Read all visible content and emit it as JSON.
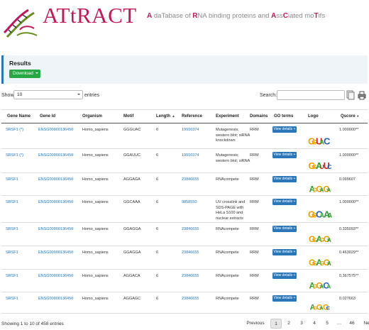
{
  "header": {
    "brand": "ATtRACT",
    "tagline_parts": [
      {
        "t": "A",
        "hl": true
      },
      {
        "t": " daTabase of ",
        "hl": false
      },
      {
        "t": "R",
        "hl": true
      },
      {
        "t": "NA binding proteins and ",
        "hl": false
      },
      {
        "t": "A",
        "hl": true
      },
      {
        "t": "ss",
        "hl": false
      },
      {
        "t": "C",
        "hl": true
      },
      {
        "t": "iated mo",
        "hl": false
      },
      {
        "t": "T",
        "hl": true
      },
      {
        "t": "ifs",
        "hl": false
      }
    ]
  },
  "results": {
    "title": "Results",
    "download_label": "Download"
  },
  "controls": {
    "show_label": "Show",
    "page_size": "10",
    "entries_label": "entries",
    "search_label": "Search:",
    "search_value": ""
  },
  "columns": [
    "Gene Name",
    "Gene Id",
    "Organism",
    "Motif",
    "Length",
    "Reference",
    "Experiment",
    "Domains",
    "GO terms",
    "Logo",
    "Qscore"
  ],
  "rows": [
    {
      "gene_name": "SRSF1 (*)",
      "gene_id": "ENSG00000136450",
      "organism": "Homo_sapiens",
      "motif": "GGGUAC",
      "length": "6",
      "reference": "19910374",
      "experiment": "Mutagenesis; western blot; siRNA knockdown",
      "domains": "RRM",
      "go_button": "View details +",
      "logo": "GGUAC",
      "qscore": "1.000000**"
    },
    {
      "gene_name": "SRSF1 (*)",
      "gene_id": "ENSG00000136450",
      "organism": "Homo_sapiens",
      "motif": "GGAUUC",
      "length": "6",
      "reference": "19910374",
      "experiment": "Mutagenesis; western blot; siRNA",
      "domains": "RRM",
      "go_button": "View details +",
      "logo": "GGAUUC",
      "qscore": "1.000000**"
    },
    {
      "gene_name": "SRSF1",
      "gene_id": "ENSG00000136450",
      "organism": "Homo_sapiens",
      "motif": "AGGAGA",
      "length": "6",
      "reference": "23846655",
      "experiment": "RNAcompete",
      "domains": "RRM",
      "go_button": "View details +",
      "logo": "AGGAGA",
      "qscore": "0.099607"
    },
    {
      "gene_name": "SRSF1",
      "gene_id": "ENSG00000136450",
      "organism": "Homo_sapiens",
      "motif": "GGCAAA",
      "length": "6",
      "reference": "9858550",
      "experiment": "UV crosslink and SDS-PAGE with HeLa S100 and nuclear extracts",
      "domains": "RRM",
      "go_button": "View details +",
      "logo": "GGCAAA",
      "qscore": "1.000000**"
    },
    {
      "gene_name": "SRSF1",
      "gene_id": "ENSG00000136450",
      "organism": "Homo_sapiens",
      "motif": "GGAGGA",
      "length": "6",
      "reference": "23846655",
      "experiment": "RNAcompete",
      "domains": "RRM",
      "go_button": "View details +",
      "logo": "GGAGGA",
      "qscore": "0.335093**"
    },
    {
      "gene_name": "SRSF1",
      "gene_id": "ENSG00000136450",
      "organism": "Homo_sapiens",
      "motif": "GGAGGA",
      "length": "6",
      "reference": "23846655",
      "experiment": "RNAcompete",
      "domains": "RRM",
      "go_button": "View details +",
      "logo": "GGAGGA",
      "qscore": "0.463029**"
    },
    {
      "gene_name": "SRSF1",
      "gene_id": "ENSG00000136450",
      "organism": "Homo_sapiens",
      "motif": "AGGACA",
      "length": "6",
      "reference": "23846655",
      "experiment": "RNAcompete",
      "domains": "RRM",
      "go_button": "View details +",
      "logo": "AGGACA",
      "qscore": "0.367575**"
    },
    {
      "gene_name": "SRSF1",
      "gene_id": "ENSG00000136450",
      "organism": "Homo_sapiens",
      "motif": "AGGAGC",
      "length": "6",
      "reference": "23846655",
      "experiment": "RNAcompete",
      "domains": "RRM",
      "go_button": "View details +",
      "logo": "AGGAGC",
      "qscore": "0.027663"
    }
  ],
  "footer": {
    "info": "Showing 1 to 10 of 458 entries",
    "previous": "Previous",
    "pages": [
      "1",
      "2",
      "3",
      "4",
      "5",
      "…",
      "46"
    ],
    "next": "Next",
    "active_page": "1"
  },
  "colors": {
    "accent": "#2a77b8",
    "brand": "#c2185b",
    "download": "#28a745"
  },
  "icons": {
    "export": "copy-icon",
    "print": "print-icon"
  }
}
